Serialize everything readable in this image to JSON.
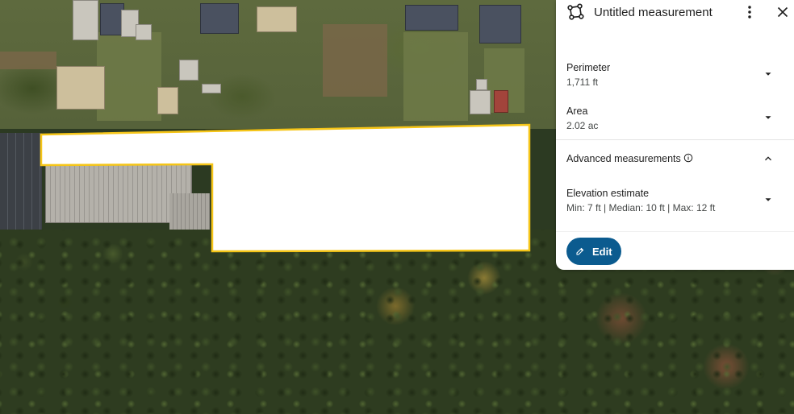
{
  "panel": {
    "title": "Untitled measurement",
    "header_icon": "polygon-measure-icon",
    "more_icon": "more-vert-icon",
    "close_icon": "close-icon"
  },
  "perimeter": {
    "label": "Perimeter",
    "value": "1,711 ft"
  },
  "area": {
    "label": "Area",
    "value": "2.02 ac"
  },
  "advanced": {
    "label": "Advanced measurements",
    "info_icon": "info-icon",
    "expanded": true
  },
  "elevation": {
    "label": "Elevation estimate",
    "value": "Min: 7 ft | Median: 10 ft | Max: 12 ft"
  },
  "edit": {
    "label": "Edit",
    "icon": "pencil-icon"
  },
  "colors": {
    "accent": "#0b5b8f",
    "polygon_outline": "#f5c518",
    "polygon_fill": "#ffffff"
  }
}
